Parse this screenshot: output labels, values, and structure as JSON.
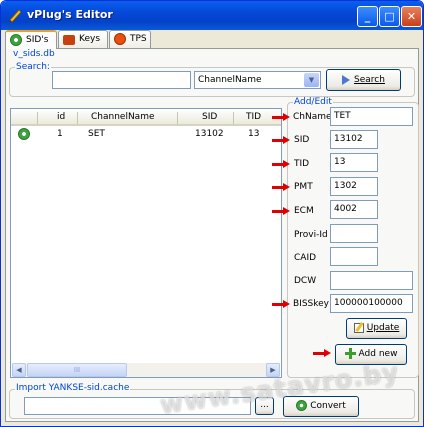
{
  "window": {
    "title": "vPlug's Editor",
    "min": "_",
    "max": "□",
    "close": "✕"
  },
  "tabs": [
    {
      "label": "SID's"
    },
    {
      "label": "Keys"
    },
    {
      "label": "TPS"
    }
  ],
  "db_label": "v_sids.db",
  "search": {
    "group_label": "Search:",
    "value": "",
    "field_selected": "ChannelName",
    "button_label": "Search"
  },
  "table": {
    "columns": [
      "id",
      "ChannelName",
      "SID",
      "TID"
    ],
    "rows": [
      {
        "id": "1",
        "channel": "SET",
        "sid": "13102",
        "tid": "13"
      }
    ],
    "scroll_label": "III"
  },
  "edit": {
    "group_label": "Add/Edit",
    "fields": [
      {
        "label": "ChName",
        "value": "TET"
      },
      {
        "label": "SID",
        "value": "13102"
      },
      {
        "label": "TID",
        "value": "13"
      },
      {
        "label": "PMT",
        "value": "1302"
      },
      {
        "label": "ECM",
        "value": "4002"
      },
      {
        "label": "Provi-Id",
        "value": ""
      },
      {
        "label": "CAID",
        "value": ""
      },
      {
        "label": "DCW",
        "value": ""
      },
      {
        "label": "BISSkey",
        "value": "100000100000"
      }
    ],
    "update_label": "Update",
    "addnew_label": "Add new"
  },
  "import": {
    "group_label": "Import YANKSE-sid.cache",
    "path": "",
    "browse_label": "...",
    "convert_label": "Convert"
  },
  "watermark": "www.satavro.by",
  "colors": {
    "title": "#0548d8",
    "arrow": "#e00000",
    "group_label": "#0046d5"
  }
}
